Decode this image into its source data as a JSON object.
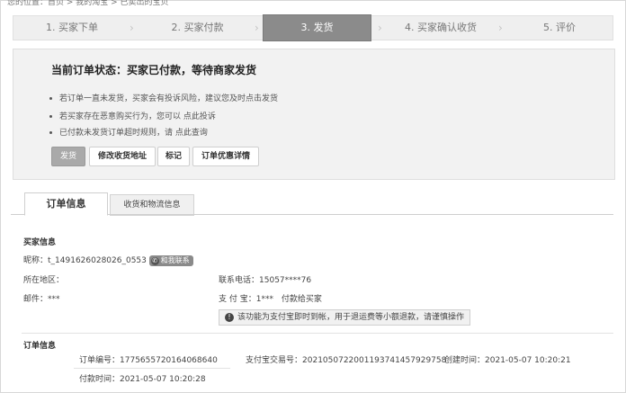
{
  "breadcrumb": "您的位置：首页 > 我的淘宝 > 已卖出的宝贝",
  "steps": [
    {
      "label": "1. 买家下单"
    },
    {
      "label": "2. 买家付款"
    },
    {
      "label": "3. 发货"
    },
    {
      "label": "4. 买家确认收货"
    },
    {
      "label": "5. 评价"
    }
  ],
  "step_arrow": "›",
  "status": {
    "title": "当前订单状态：买家已付款，等待商家发货",
    "tips": [
      "若订单一直未发货，买家会有投诉风险，建议您及时点击发货",
      "若买家存在恶意购买行为，您可以 点此投诉",
      "已付款未发货订单超时规则，请 点此查询"
    ],
    "buttons": {
      "ship": "发货",
      "edit_address": "修改收货地址",
      "mark": "标记",
      "discount": "订单优惠详情"
    }
  },
  "tabs": {
    "order_info": "订单信息",
    "shipping_info": "收货和物流信息"
  },
  "buyer": {
    "section_title": "买家信息",
    "nickname_label": "昵称：",
    "nickname": "t_1491626028026_0553",
    "contact_badge": "和我联系",
    "region_label": "所在地区：",
    "region": "",
    "phone_label": "联系电话：",
    "phone": "15057****76",
    "email_label": "邮件：",
    "email": "***",
    "alipay_label": "支 付 宝：",
    "alipay": "1***",
    "pay_buyer": "付款给买家",
    "notice": "该功能为支付宝即时到帐，用于退运费等小额退款，请谨慎操作"
  },
  "order": {
    "section_title": "订单信息",
    "order_no_label": "订单编号：",
    "order_no": "1775655720164068640",
    "alipay_trade_label": "支付宝交易号：",
    "alipay_trade": "2021050722001193741457929758",
    "created_label": "创建时间：",
    "created": "2021-05-07 10:20:21",
    "paid_label": "付款时间：",
    "paid": "2021-05-07 10:20:28"
  },
  "colors": {
    "active_step_bg": "#8b8b8b",
    "panel_bg": "#f2f2f2",
    "primary_button": "#a9a9a9"
  },
  "icons": {
    "info": "info-icon",
    "contact": "contact-icon"
  }
}
